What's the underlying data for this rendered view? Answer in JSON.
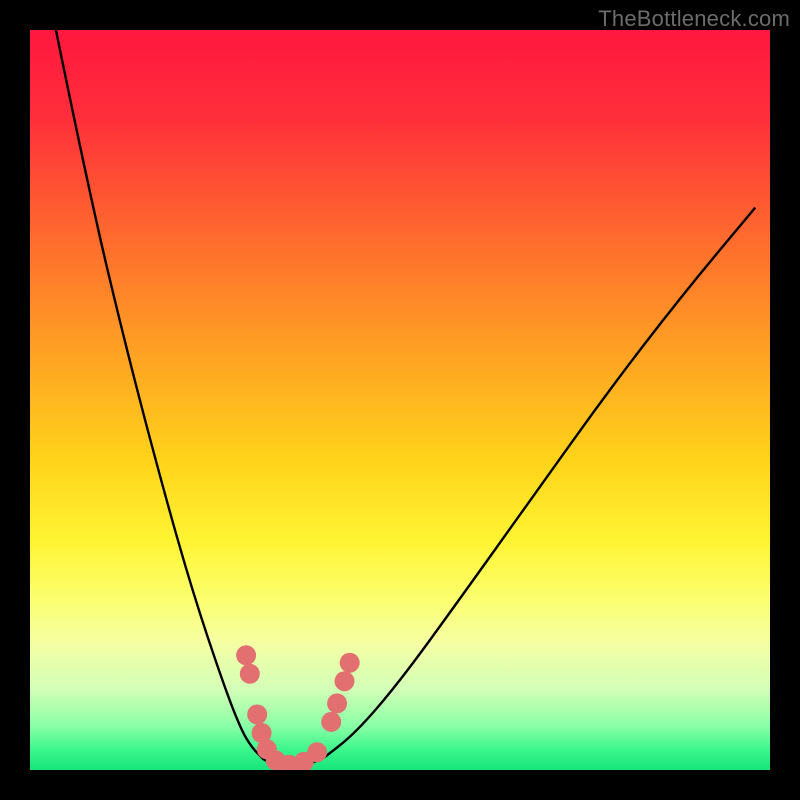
{
  "watermark": "TheBottleneck.com",
  "colors": {
    "frame": "#000000",
    "watermark": "#6c6c6c",
    "curve_stroke": "#000000",
    "marker_fill": "#e27071",
    "gradient_stops": [
      {
        "offset": 0.0,
        "color": "#ff173f"
      },
      {
        "offset": 0.12,
        "color": "#ff2f3a"
      },
      {
        "offset": 0.28,
        "color": "#ff6a2e"
      },
      {
        "offset": 0.44,
        "color": "#ffa323"
      },
      {
        "offset": 0.58,
        "color": "#ffd31a"
      },
      {
        "offset": 0.69,
        "color": "#fff432"
      },
      {
        "offset": 0.77,
        "color": "#fcff70"
      },
      {
        "offset": 0.83,
        "color": "#f4ffa4"
      },
      {
        "offset": 0.89,
        "color": "#d4ffb7"
      },
      {
        "offset": 0.94,
        "color": "#8bffa6"
      },
      {
        "offset": 0.975,
        "color": "#37f58a"
      },
      {
        "offset": 1.0,
        "color": "#16e57a"
      }
    ]
  },
  "chart_data": {
    "type": "line",
    "title": "",
    "xlabel": "",
    "ylabel": "",
    "xlim": [
      0,
      1
    ],
    "ylim": [
      0,
      1
    ],
    "notes": "Abstract bottleneck V-curve with color gradient background (red at top → green at bottom). Axes have no ticks or labels. Curve minimum sits very close to y=0 at roughly x≈0.34; left branch rises steeply to top-left corner; right branch rises more gradually toward upper-right. Salmon circular markers cluster near the trough.",
    "series": [
      {
        "name": "left-branch",
        "x": [
          0.035,
          0.08,
          0.13,
          0.18,
          0.22,
          0.26,
          0.285,
          0.3,
          0.315
        ],
        "y": [
          1.0,
          0.78,
          0.57,
          0.38,
          0.24,
          0.12,
          0.055,
          0.03,
          0.015
        ]
      },
      {
        "name": "trough",
        "x": [
          0.315,
          0.33,
          0.35,
          0.37,
          0.395
        ],
        "y": [
          0.015,
          0.006,
          0.003,
          0.006,
          0.015
        ]
      },
      {
        "name": "right-branch",
        "x": [
          0.395,
          0.44,
          0.5,
          0.58,
          0.68,
          0.78,
          0.88,
          0.98
        ],
        "y": [
          0.015,
          0.05,
          0.12,
          0.23,
          0.37,
          0.51,
          0.64,
          0.76
        ]
      }
    ],
    "markers": [
      {
        "x": 0.292,
        "y": 0.155
      },
      {
        "x": 0.297,
        "y": 0.13
      },
      {
        "x": 0.307,
        "y": 0.075
      },
      {
        "x": 0.313,
        "y": 0.05
      },
      {
        "x": 0.32,
        "y": 0.028
      },
      {
        "x": 0.332,
        "y": 0.013
      },
      {
        "x": 0.35,
        "y": 0.007
      },
      {
        "x": 0.37,
        "y": 0.011
      },
      {
        "x": 0.388,
        "y": 0.024
      },
      {
        "x": 0.407,
        "y": 0.065
      },
      {
        "x": 0.415,
        "y": 0.09
      },
      {
        "x": 0.425,
        "y": 0.12
      },
      {
        "x": 0.432,
        "y": 0.145
      }
    ]
  }
}
